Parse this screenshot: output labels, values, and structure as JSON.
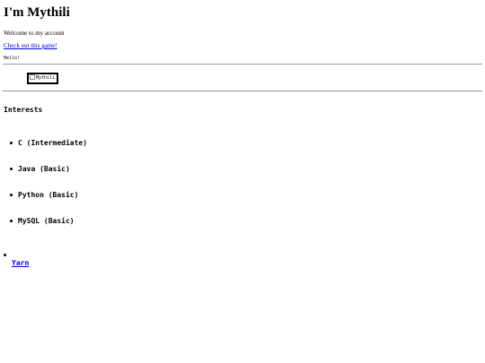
{
  "header": {
    "title": "I'm Mythili",
    "welcome": "Welcome to my account",
    "game_link": "Check out this game!",
    "hello": "Hello!"
  },
  "avatar": {
    "alt_text": "Mythili",
    "icon": "broken-image-icon"
  },
  "interests": {
    "title": "Interests",
    "items": [
      {
        "label": "C (Intermediate)"
      },
      {
        "label": "Java (Basic)"
      },
      {
        "label": "Python (Basic)"
      },
      {
        "label": "MySQL (Basic)"
      }
    ]
  },
  "links": {
    "yarn": "Yarn"
  },
  "colors": {
    "link": "#0000ee",
    "rule": "#999999",
    "background": "#ffffff"
  }
}
